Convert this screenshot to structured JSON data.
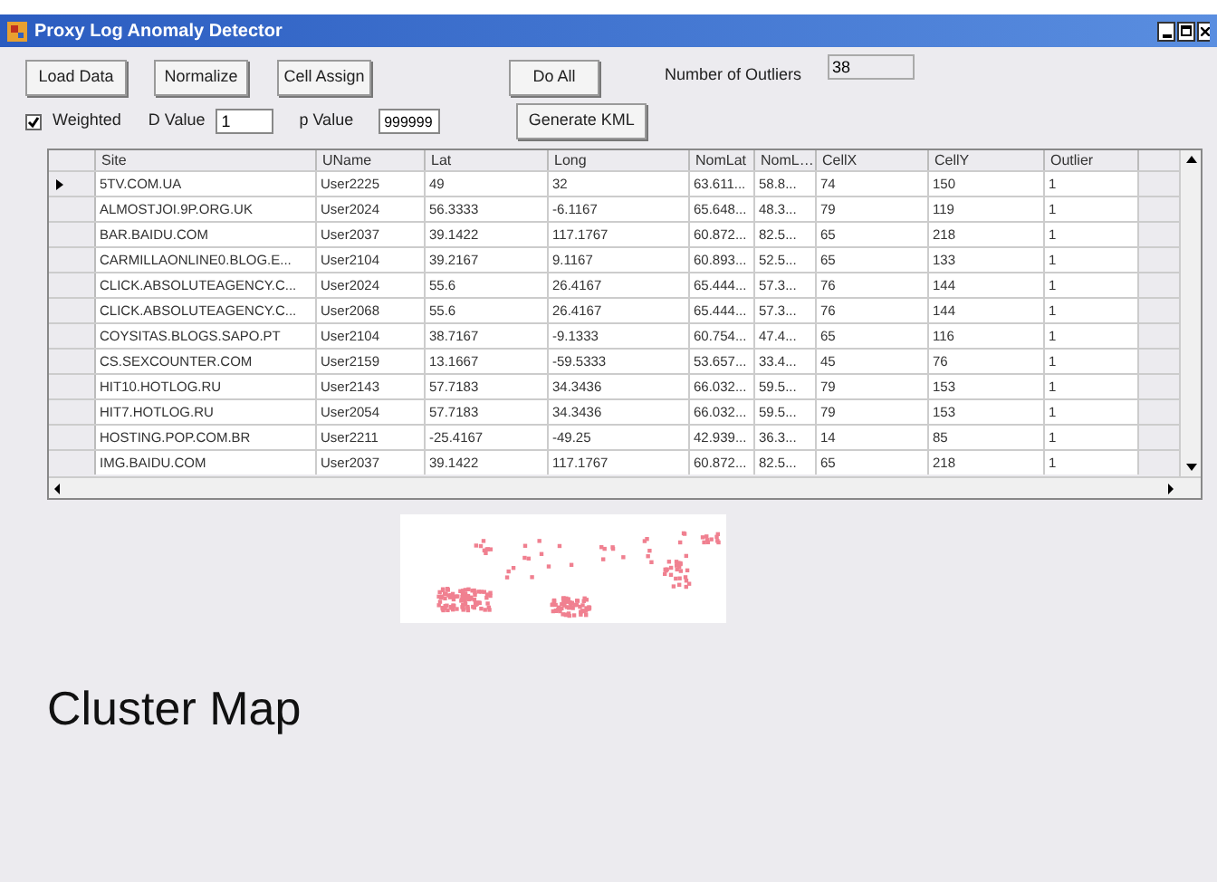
{
  "window": {
    "title": "Proxy Log Anomaly Detector"
  },
  "buttons": [
    {
      "label": "Load Data"
    },
    {
      "label": "Normalize"
    },
    {
      "label": "Cell Assign"
    },
    {
      "label": "Do All"
    }
  ],
  "outliers": {
    "label": "Number of Outliers",
    "value": "38"
  },
  "weighted": {
    "label": "Weighted",
    "checked": true
  },
  "d_value": {
    "label": "D Value",
    "value": "1"
  },
  "p_value": {
    "label": "p Value",
    "value": "999999"
  },
  "generate_button": {
    "label": "Generate KML"
  },
  "table": {
    "columns": [
      "Site",
      "UName",
      "Lat",
      "Long",
      "NomLat",
      "NomL…",
      "CellX",
      "CellY",
      "Outlier"
    ],
    "rows": [
      {
        "selected": true,
        "cells": [
          "5TV.COM.UA",
          "User2225",
          "49",
          "32",
          "63.611...",
          "58.8...",
          "74",
          "150",
          "1"
        ]
      },
      {
        "selected": false,
        "cells": [
          "ALMOSTJOI.9P.ORG.UK",
          "User2024",
          "56.3333",
          "-6.1167",
          "65.648...",
          "48.3...",
          "79",
          "119",
          "1"
        ]
      },
      {
        "selected": false,
        "cells": [
          "BAR.BAIDU.COM",
          "User2037",
          "39.1422",
          "117.1767",
          "60.872...",
          "82.5...",
          "65",
          "218",
          "1"
        ]
      },
      {
        "selected": false,
        "cells": [
          "CARMILLAONLINE0.BLOG.E...",
          "User2104",
          "39.2167",
          "9.1167",
          "60.893...",
          "52.5...",
          "65",
          "133",
          "1"
        ]
      },
      {
        "selected": false,
        "cells": [
          "CLICK.ABSOLUTEAGENCY.C...",
          "User2024",
          "55.6",
          "26.4167",
          "65.444...",
          "57.3...",
          "76",
          "144",
          "1"
        ]
      },
      {
        "selected": false,
        "cells": [
          "CLICK.ABSOLUTEAGENCY.C...",
          "User2068",
          "55.6",
          "26.4167",
          "65.444...",
          "57.3...",
          "76",
          "144",
          "1"
        ]
      },
      {
        "selected": false,
        "cells": [
          "COYSITAS.BLOGS.SAPO.PT",
          "User2104",
          "38.7167",
          "-9.1333",
          "60.754...",
          "47.4...",
          "65",
          "116",
          "1"
        ]
      },
      {
        "selected": false,
        "cells": [
          "CS.SEXCOUNTER.COM",
          "User2159",
          "13.1667",
          "-59.5333",
          "53.657...",
          "33.4...",
          "45",
          "76",
          "1"
        ]
      },
      {
        "selected": false,
        "cells": [
          "HIT10.HOTLOG.RU",
          "User2143",
          "57.7183",
          "34.3436",
          "66.032...",
          "59.5...",
          "79",
          "153",
          "1"
        ]
      },
      {
        "selected": false,
        "cells": [
          "HIT7.HOTLOG.RU",
          "User2054",
          "57.7183",
          "34.3436",
          "66.032...",
          "59.5...",
          "79",
          "153",
          "1"
        ]
      },
      {
        "selected": false,
        "cells": [
          "HOSTING.POP.COM.BR",
          "User2211",
          "-25.4167",
          "-49.25",
          "42.939...",
          "36.3...",
          "14",
          "85",
          "1"
        ]
      },
      {
        "selected": false,
        "cells": [
          "IMG.BAIDU.COM",
          "User2037",
          "39.1422",
          "117.1767",
          "60.872...",
          "82.5...",
          "65",
          "218",
          "1"
        ]
      }
    ]
  },
  "cluster_map": {
    "title": "Cluster Map"
  }
}
